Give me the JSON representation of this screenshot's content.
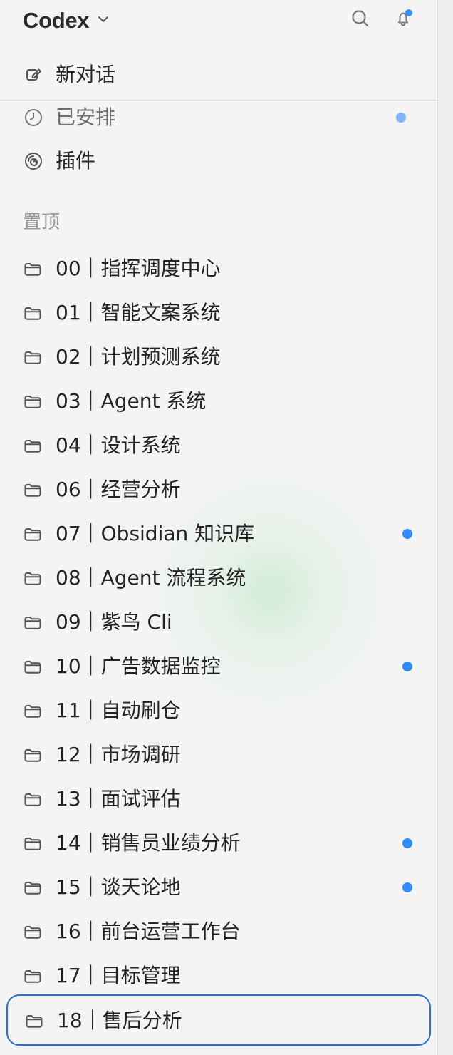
{
  "app": {
    "title": "Codex"
  },
  "colors": {
    "accent": "#2d6ae3",
    "unread_dot": "#2f8cff"
  },
  "icons": {
    "title_dropdown": "chevron-down-icon",
    "search": "search-icon",
    "notifications": "bell-icon",
    "new_chat": "edit-icon",
    "scheduled": "clock-icon",
    "plugins": "plugin-icon",
    "folder": "folder-icon"
  },
  "sidebar": {
    "top_items": [
      {
        "label": "新对话"
      },
      {
        "label": "已安排"
      },
      {
        "label": "插件"
      }
    ],
    "pinned_title": "置顶",
    "projects": [
      {
        "label": "00｜指挥调度中心",
        "unread": false,
        "selected": false
      },
      {
        "label": "01｜智能文案系统",
        "unread": false,
        "selected": false
      },
      {
        "label": "02｜计划预测系统",
        "unread": false,
        "selected": false
      },
      {
        "label": "03｜Agent 系统",
        "unread": false,
        "selected": false
      },
      {
        "label": "04｜设计系统",
        "unread": false,
        "selected": false
      },
      {
        "label": "06｜经营分析",
        "unread": false,
        "selected": false
      },
      {
        "label": "07｜Obsidian 知识库",
        "unread": true,
        "selected": false
      },
      {
        "label": "08｜Agent 流程系统",
        "unread": false,
        "selected": false
      },
      {
        "label": "09｜紫鸟 Cli",
        "unread": false,
        "selected": false
      },
      {
        "label": "10｜广告数据监控",
        "unread": true,
        "selected": false
      },
      {
        "label": "11｜自动刷仓",
        "unread": false,
        "selected": false
      },
      {
        "label": "12｜市场调研",
        "unread": false,
        "selected": false
      },
      {
        "label": "13｜面试评估",
        "unread": false,
        "selected": false
      },
      {
        "label": "14｜销售员业绩分析",
        "unread": true,
        "selected": false
      },
      {
        "label": "15｜谈天论地",
        "unread": true,
        "selected": false
      },
      {
        "label": "16｜前台运营工作台",
        "unread": false,
        "selected": false
      },
      {
        "label": "17｜目标管理",
        "unread": false,
        "selected": false
      },
      {
        "label": "18｜售后分析",
        "unread": false,
        "selected": true
      }
    ]
  }
}
